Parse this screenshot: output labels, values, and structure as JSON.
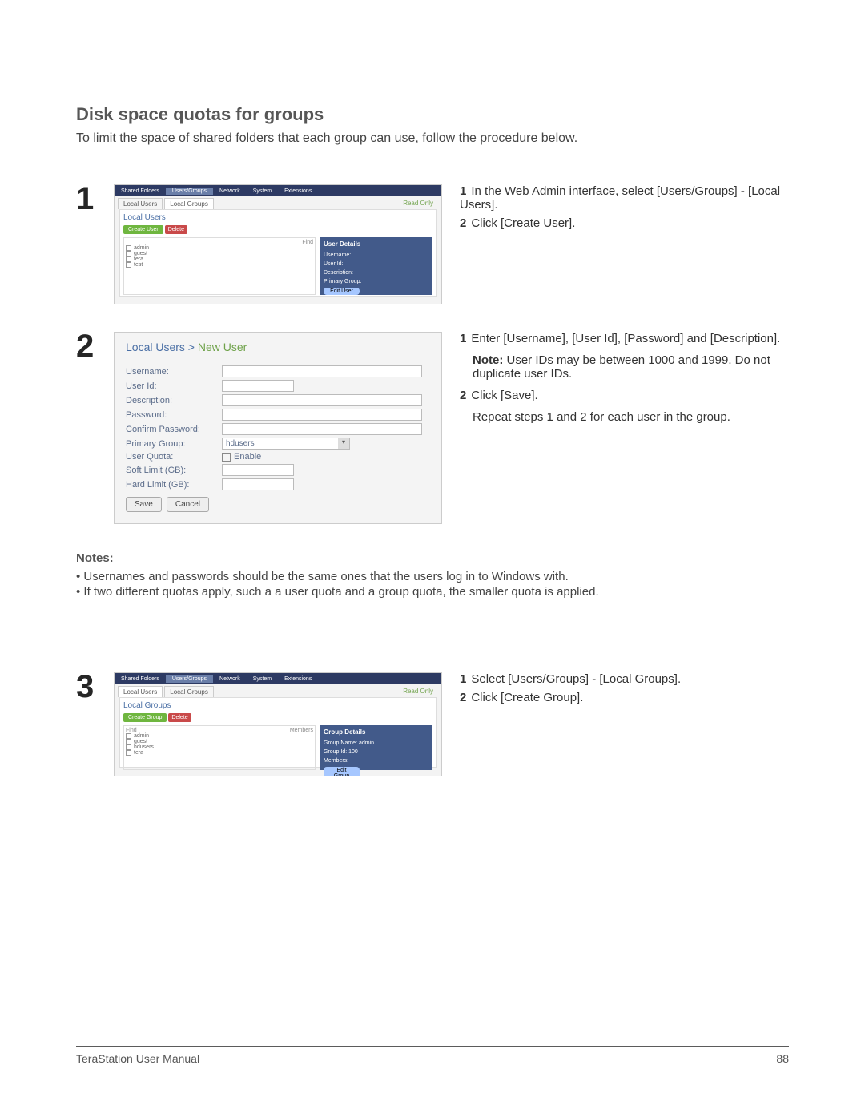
{
  "header": {
    "title": "Disk space quotas for groups",
    "intro": "To limit the space of shared folders that each group can use, follow the procedure below."
  },
  "steps": {
    "s1": {
      "num": "1",
      "i1": "In the Web Admin interface, select [Users/Groups] - [Local Users].",
      "i2": "Click [Create User]."
    },
    "s2": {
      "num": "2",
      "i1": "Enter [Username], [User Id], [Password] and [Description].",
      "note_label": "Note:",
      "note_text": "User IDs may be between 1000 and 1999.  Do not duplicate user IDs.",
      "i2": "Click [Save].",
      "repeat": "Repeat steps 1 and 2 for each user in the group."
    },
    "s3": {
      "num": "3",
      "i1": "Select [Users/Groups] - [Local Groups].",
      "i2": "Click [Create Group]."
    }
  },
  "shot1": {
    "tabs": {
      "shared": "Shared Folders",
      "users": "Users/Groups",
      "network": "Network",
      "system": "System",
      "ext": "Extensions"
    },
    "subtabs": {
      "lu": "Local Users",
      "lg": "Local Groups"
    },
    "readonly": "Read Only",
    "panelTitle": "Local Users",
    "toolbar": {
      "create": "Create User",
      "delete": "Delete"
    },
    "colFind": "Find",
    "rows": [
      "admin",
      "guest",
      "tera",
      "test"
    ],
    "details": {
      "head": "User Details",
      "r1": "Username:",
      "r2": "User Id:",
      "r3": "Description:",
      "r4": "Primary Group:",
      "btn": "Edit User"
    }
  },
  "shot2": {
    "breadcrumb_a": "Local Users",
    "breadcrumb_sep": " > ",
    "breadcrumb_b": "New User",
    "labels": {
      "username": "Username:",
      "userid": "User Id:",
      "description": "Description:",
      "password": "Password:",
      "confirm": "Confirm Password:",
      "primary": "Primary Group:",
      "quota": "User Quota:",
      "soft": "Soft Limit (GB):",
      "hard": "Hard Limit (GB):"
    },
    "primary_value": "hdusers",
    "enable": "Enable",
    "save": "Save",
    "cancel": "Cancel"
  },
  "shot3": {
    "tabs": {
      "shared": "Shared Folders",
      "users": "Users/Groups",
      "network": "Network",
      "system": "System",
      "ext": "Extensions"
    },
    "subtabs": {
      "lu": "Local Users",
      "lg": "Local Groups"
    },
    "readonly": "Read Only",
    "panelTitle": "Local Groups",
    "toolbar": {
      "create": "Create Group",
      "delete": "Delete"
    },
    "colFind": "Find",
    "colMembers": "Members",
    "rows": [
      "admin",
      "guest",
      "hdusers",
      "tera"
    ],
    "details": {
      "head": "Group Details",
      "r1": "Group Name:",
      "r2": "Group Id:",
      "r3": "Members:",
      "v1": "admin",
      "v2": "100",
      "btn": "Edit Group"
    }
  },
  "notes": {
    "head": "Notes:",
    "b1": "• Usernames and passwords should be the same ones that the users log in to Windows with.",
    "b2": "• If two different quotas apply, such a a user quota and a group quota, the smaller quota is applied."
  },
  "footer": {
    "manual": "TeraStation User Manual",
    "page": "88"
  }
}
